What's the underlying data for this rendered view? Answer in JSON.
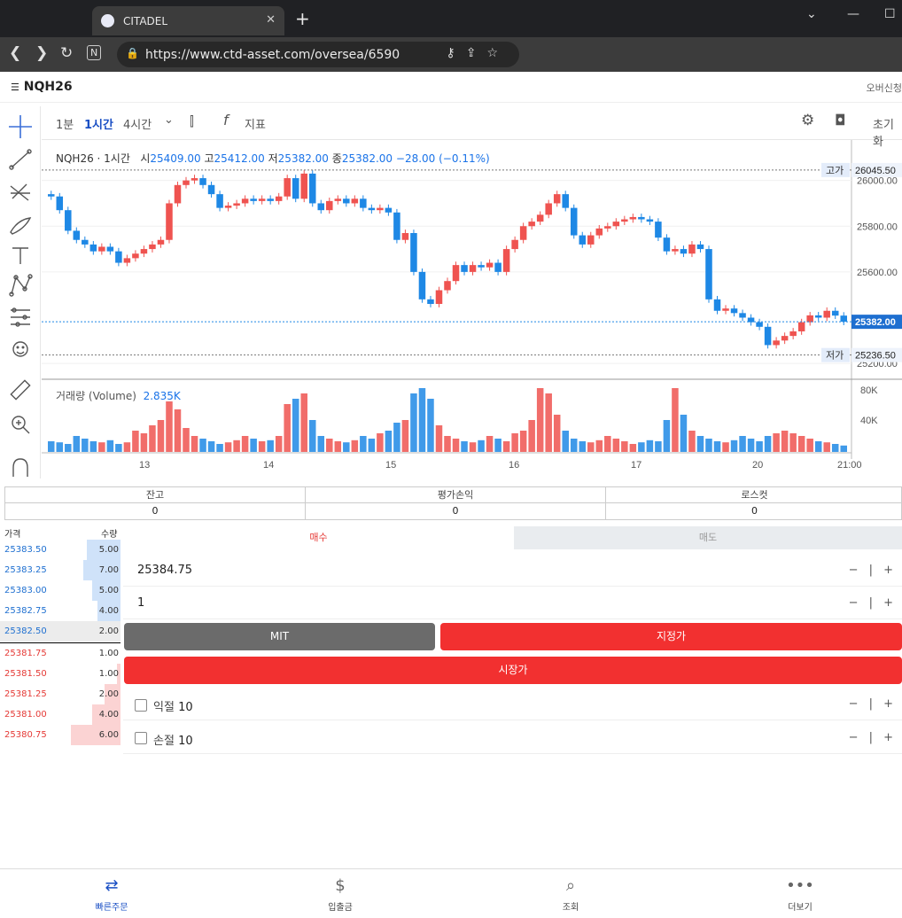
{
  "browser": {
    "tab_title": "CITADEL",
    "url": "https://www.ctd-asset.com/oversea/6590",
    "new_tab_glyph": "+",
    "close_glyph": "✕"
  },
  "header": {
    "menu_glyph": "☰",
    "symbol": "NQH26",
    "right_link": "오버신청"
  },
  "chart_toolbar": {
    "intervals": [
      "1분",
      "1시간",
      "4시간"
    ],
    "active_interval": "1시간",
    "indicator_label": "지표",
    "reset_label": "초기화"
  },
  "chart_data": {
    "type": "candlestick",
    "symbol": "NQH26",
    "interval": "1시간",
    "ohlc": {
      "open_label": "시",
      "open": "25409.00",
      "high_label": "고",
      "high": "25412.00",
      "low_label": "저",
      "low": "25382.00",
      "close_label": "종",
      "close": "25382.00",
      "change": "−28.00 (−0.11%)"
    },
    "price_axis": {
      "ticks": [
        "26000.00",
        "25800.00",
        "25600.00",
        "25200.00"
      ],
      "range": [
        25150,
        26080
      ]
    },
    "markers": [
      {
        "label": "고가",
        "value": "26045.50"
      },
      {
        "label": "",
        "value": "25382.00"
      },
      {
        "label": "저가",
        "value": "25236.50"
      }
    ],
    "x_ticks": [
      "13",
      "14",
      "15",
      "16",
      "17",
      "20",
      "21:00"
    ],
    "volume": {
      "label": "거래량 (Volume)",
      "last": "2.835K",
      "ticks": [
        "80K",
        "40K"
      ]
    },
    "series": [
      {
        "o": 25940,
        "c": 25930
      },
      {
        "o": 25930,
        "c": 25870
      },
      {
        "o": 25870,
        "c": 25780
      },
      {
        "o": 25780,
        "c": 25740
      },
      {
        "o": 25740,
        "c": 25720
      },
      {
        "o": 25720,
        "c": 25690
      },
      {
        "o": 25690,
        "c": 25710
      },
      {
        "o": 25710,
        "c": 25690
      },
      {
        "o": 25690,
        "c": 25640
      },
      {
        "o": 25640,
        "c": 25660
      },
      {
        "o": 25660,
        "c": 25680
      },
      {
        "o": 25680,
        "c": 25700
      },
      {
        "o": 25700,
        "c": 25720
      },
      {
        "o": 25720,
        "c": 25740
      },
      {
        "o": 25740,
        "c": 25900
      },
      {
        "o": 25900,
        "c": 25980
      },
      {
        "o": 25980,
        "c": 26000
      },
      {
        "o": 26000,
        "c": 26010
      },
      {
        "o": 26010,
        "c": 25980
      },
      {
        "o": 25980,
        "c": 25940
      },
      {
        "o": 25940,
        "c": 25880
      },
      {
        "o": 25880,
        "c": 25890
      },
      {
        "o": 25890,
        "c": 25900
      },
      {
        "o": 25900,
        "c": 25920
      },
      {
        "o": 25920,
        "c": 25910
      },
      {
        "o": 25910,
        "c": 25920
      },
      {
        "o": 25920,
        "c": 25910
      },
      {
        "o": 25910,
        "c": 25930
      },
      {
        "o": 25930,
        "c": 26010
      },
      {
        "o": 26010,
        "c": 25920
      },
      {
        "o": 25920,
        "c": 26030
      },
      {
        "o": 26030,
        "c": 25900
      },
      {
        "o": 25900,
        "c": 25870
      },
      {
        "o": 25870,
        "c": 25910
      },
      {
        "o": 25910,
        "c": 25920
      },
      {
        "o": 25920,
        "c": 25900
      },
      {
        "o": 25900,
        "c": 25920
      },
      {
        "o": 25920,
        "c": 25880
      },
      {
        "o": 25880,
        "c": 25870
      },
      {
        "o": 25870,
        "c": 25880
      },
      {
        "o": 25880,
        "c": 25860
      },
      {
        "o": 25860,
        "c": 25740
      },
      {
        "o": 25740,
        "c": 25770
      },
      {
        "o": 25770,
        "c": 25600
      },
      {
        "o": 25600,
        "c": 25480
      },
      {
        "o": 25480,
        "c": 25460
      },
      {
        "o": 25460,
        "c": 25520
      },
      {
        "o": 25520,
        "c": 25560
      },
      {
        "o": 25560,
        "c": 25630
      },
      {
        "o": 25630,
        "c": 25600
      },
      {
        "o": 25600,
        "c": 25630
      },
      {
        "o": 25630,
        "c": 25620
      },
      {
        "o": 25620,
        "c": 25640
      },
      {
        "o": 25640,
        "c": 25600
      },
      {
        "o": 25600,
        "c": 25700
      },
      {
        "o": 25700,
        "c": 25740
      },
      {
        "o": 25740,
        "c": 25800
      },
      {
        "o": 25800,
        "c": 25820
      },
      {
        "o": 25820,
        "c": 25850
      },
      {
        "o": 25850,
        "c": 25900
      },
      {
        "o": 25900,
        "c": 25940
      },
      {
        "o": 25940,
        "c": 25880
      },
      {
        "o": 25880,
        "c": 25760
      },
      {
        "o": 25760,
        "c": 25720
      },
      {
        "o": 25720,
        "c": 25760
      },
      {
        "o": 25760,
        "c": 25790
      },
      {
        "o": 25790,
        "c": 25800
      },
      {
        "o": 25800,
        "c": 25820
      },
      {
        "o": 25820,
        "c": 25830
      },
      {
        "o": 25830,
        "c": 25840
      },
      {
        "o": 25840,
        "c": 25830
      },
      {
        "o": 25830,
        "c": 25820
      },
      {
        "o": 25820,
        "c": 25750
      },
      {
        "o": 25750,
        "c": 25690
      },
      {
        "o": 25690,
        "c": 25700
      },
      {
        "o": 25700,
        "c": 25680
      },
      {
        "o": 25680,
        "c": 25720
      },
      {
        "o": 25720,
        "c": 25700
      },
      {
        "o": 25700,
        "c": 25480
      },
      {
        "o": 25480,
        "c": 25430
      },
      {
        "o": 25430,
        "c": 25440
      },
      {
        "o": 25440,
        "c": 25420
      },
      {
        "o": 25420,
        "c": 25400
      },
      {
        "o": 25400,
        "c": 25380
      },
      {
        "o": 25380,
        "c": 25360
      },
      {
        "o": 25360,
        "c": 25280
      },
      {
        "o": 25280,
        "c": 25300
      },
      {
        "o": 25300,
        "c": 25320
      },
      {
        "o": 25320,
        "c": 25340
      },
      {
        "o": 25340,
        "c": 25380
      },
      {
        "o": 25380,
        "c": 25410
      },
      {
        "o": 25410,
        "c": 25400
      },
      {
        "o": 25400,
        "c": 25430
      },
      {
        "o": 25430,
        "c": 25409
      },
      {
        "o": 25409,
        "c": 25382
      }
    ],
    "volumes": [
      20,
      18,
      15,
      30,
      25,
      20,
      18,
      22,
      15,
      18,
      40,
      35,
      50,
      60,
      95,
      80,
      45,
      30,
      25,
      20,
      15,
      18,
      22,
      30,
      25,
      20,
      22,
      30,
      90,
      100,
      110,
      60,
      30,
      25,
      20,
      18,
      22,
      30,
      25,
      35,
      40,
      55,
      60,
      110,
      120,
      100,
      50,
      30,
      25,
      20,
      18,
      22,
      30,
      25,
      20,
      35,
      40,
      60,
      120,
      110,
      70,
      40,
      25,
      20,
      18,
      22,
      30,
      25,
      20,
      15,
      18,
      22,
      20,
      60,
      120,
      70,
      40,
      30,
      25,
      20,
      18,
      22,
      30,
      25,
      20,
      30,
      35,
      40,
      35,
      30,
      25,
      20,
      18,
      15,
      12
    ]
  },
  "left_tools": [
    "crosshair-icon",
    "trend-line-icon",
    "fib-icon",
    "brush-icon",
    "text-icon",
    "pattern-icon",
    "forecast-icon",
    "emoji-icon",
    "ruler-icon",
    "zoom-icon",
    "magnet-icon"
  ],
  "account_info": {
    "cols": [
      {
        "label": "잔고",
        "value": "0"
      },
      {
        "label": "평가손익",
        "value": "0"
      },
      {
        "label": "로스컷",
        "value": "0"
      }
    ]
  },
  "orderbook": {
    "price_header": "가격",
    "qty_header": "수량",
    "asks": [
      {
        "price": "25383.50",
        "qty": "5.00"
      },
      {
        "price": "25383.25",
        "qty": "7.00"
      },
      {
        "price": "25383.00",
        "qty": "5.00"
      },
      {
        "price": "25382.75",
        "qty": "4.00"
      },
      {
        "price": "25382.50",
        "qty": "2.00"
      }
    ],
    "bids": [
      {
        "price": "25381.75",
        "qty": "1.00"
      },
      {
        "price": "25381.50",
        "qty": "1.00"
      },
      {
        "price": "25381.25",
        "qty": "2.00"
      },
      {
        "price": "25381.00",
        "qty": "4.00"
      },
      {
        "price": "25380.75",
        "qty": "6.00"
      }
    ]
  },
  "order_form": {
    "buy_tab": "매수",
    "sell_tab": "매도",
    "price": "25384.75",
    "qty": "1",
    "stepper": "− | +",
    "mit_label": "MIT",
    "limit_label": "지정가",
    "market_label": "시장가",
    "take_profit_label": "익절",
    "take_profit_value": "10",
    "stop_loss_label": "손절",
    "stop_loss_value": "10"
  },
  "colors": {
    "up": "#ef5350",
    "down": "#1e88e5",
    "buy": "#f23030",
    "mit": "#6b6b6b"
  },
  "bottom_nav": [
    {
      "label": "빠른주문",
      "icon": "⇄"
    },
    {
      "label": "입출금",
      "icon": "$"
    },
    {
      "label": "조회",
      "icon": "⌕"
    },
    {
      "label": "더보기",
      "icon": "•••"
    }
  ]
}
